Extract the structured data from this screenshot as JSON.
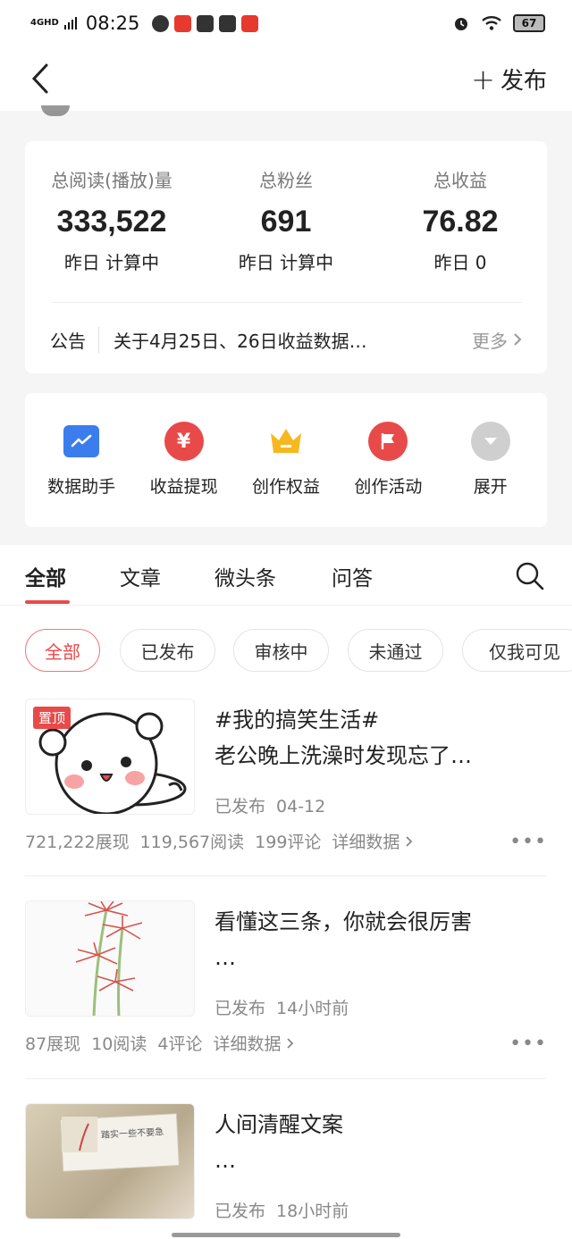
{
  "status_bar": {
    "network": "4GHD",
    "time": "08:25",
    "battery": "67",
    "colors": {
      "app_red": "#e8392f",
      "app_black": "#333333"
    }
  },
  "header": {
    "back_icon": "chevron-left-icon",
    "publish_label": "发布"
  },
  "stats": {
    "items": [
      {
        "label": "总阅读(播放)量",
        "value": "333,522",
        "sub": "昨日 计算中"
      },
      {
        "label": "总粉丝",
        "value": "691",
        "sub": "昨日 计算中"
      },
      {
        "label": "总收益",
        "value": "76.82",
        "sub": "昨日 0"
      }
    ],
    "notice_tag": "公告",
    "notice_text": "关于4月25日、26日收益数据…",
    "notice_more": "更多"
  },
  "tools": [
    {
      "label": "数据助手",
      "icon": "trend-chart-icon",
      "color": "#3b7ded"
    },
    {
      "label": "收益提现",
      "icon": "yuan-icon",
      "color": "#e84a4a"
    },
    {
      "label": "创作权益",
      "icon": "crown-icon",
      "color": "#f6b820"
    },
    {
      "label": "创作活动",
      "icon": "flag-icon",
      "color": "#e84a4a"
    },
    {
      "label": "展开",
      "icon": "chevron-down-icon",
      "color": "#cccccc"
    }
  ],
  "tabs": [
    "全部",
    "文章",
    "微头条",
    "问答"
  ],
  "filters": [
    "全部",
    "已发布",
    "审核中",
    "未通过",
    "仅我可见"
  ],
  "posts": [
    {
      "pinned": "置顶",
      "title_line1": "#我的搞笑生活#",
      "title_line2": "老公晚上洗澡时发现忘了…",
      "status": "已发布",
      "time": "04-12",
      "impressions": "721,222展现",
      "reads": "119,567阅读",
      "comments": "199评论",
      "details": "详细数据"
    },
    {
      "title_line1": "看懂这三条，你就会很厉害",
      "title_line2": "…",
      "status": "已发布",
      "time": "14小时前",
      "impressions": "87展现",
      "reads": "10阅读",
      "comments": "4评论",
      "details": "详细数据"
    },
    {
      "title_line1": "人间清醒文案",
      "title_line2": "…",
      "status": "已发布",
      "time": "18小时前",
      "thumb_text": "踏实一些不要急"
    }
  ],
  "accent": "#e84a4a"
}
